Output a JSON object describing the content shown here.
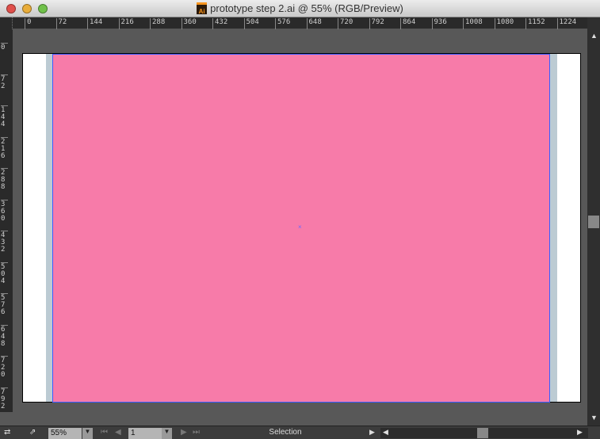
{
  "window": {
    "title": "prototype step 2.ai @ 55% (RGB/Preview)",
    "app_icon_label": "Ai"
  },
  "rulers": {
    "top_labels": [
      "0",
      "72",
      "144",
      "216",
      "288",
      "360",
      "432",
      "504",
      "576",
      "648",
      "720",
      "792",
      "864",
      "936",
      "1008",
      "1080",
      "1152",
      "1224"
    ],
    "left_labels": [
      "0",
      "72",
      "144",
      "216",
      "288",
      "360",
      "432",
      "504",
      "576",
      "648",
      "720",
      "792"
    ]
  },
  "document": {
    "fill_color": "#F77BA9"
  },
  "status": {
    "zoom": "55%",
    "page": "1",
    "tool": "Selection"
  }
}
